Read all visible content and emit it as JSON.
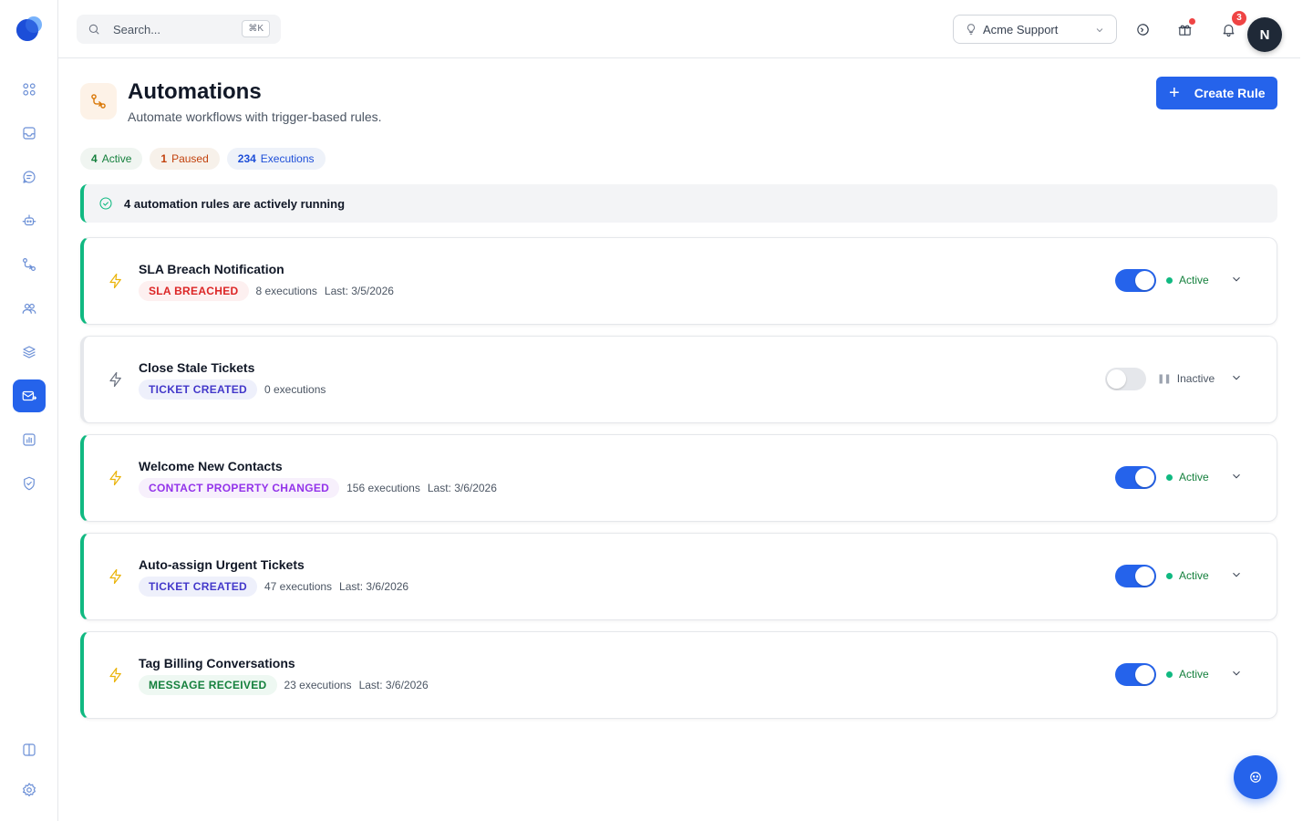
{
  "search": {
    "placeholder": "Search...",
    "shortcut": "⌘K"
  },
  "workspace": {
    "label": "Acme Support"
  },
  "notifications": {
    "count": "3"
  },
  "user": {
    "initial": "N"
  },
  "page": {
    "title": "Automations",
    "subtitle": "Automate workflows with trigger-based rules.",
    "create_label": "Create Rule"
  },
  "stats": [
    {
      "num": "4",
      "label": "Active"
    },
    {
      "num": "1",
      "label": "Paused"
    },
    {
      "num": "234",
      "label": "Executions"
    }
  ],
  "banner": {
    "text": "4 automation rules are actively running"
  },
  "rules": [
    {
      "name": "SLA Breach Notification",
      "trigger": "SLA BREACHED",
      "executions": "8 executions",
      "last": "Last: 3/5/2026",
      "status": "Active"
    },
    {
      "name": "Close Stale Tickets",
      "trigger": "TICKET CREATED",
      "executions": "0 executions",
      "last": "",
      "status": "Inactive"
    },
    {
      "name": "Welcome New Contacts",
      "trigger": "CONTACT PROPERTY CHANGED",
      "executions": "156 executions",
      "last": "Last: 3/6/2026",
      "status": "Active"
    },
    {
      "name": "Auto-assign Urgent Tickets",
      "trigger": "TICKET CREATED",
      "executions": "47 executions",
      "last": "Last: 3/6/2026",
      "status": "Active"
    },
    {
      "name": "Tag Billing Conversations",
      "trigger": "MESSAGE RECEIVED",
      "executions": "23 executions",
      "last": "Last: 3/6/2026",
      "status": "Active"
    }
  ],
  "colors": {
    "accent": "#2563eb",
    "active_green": "#10b981",
    "bolt_active": "#eab308",
    "bolt_inactive": "#6b7280"
  }
}
